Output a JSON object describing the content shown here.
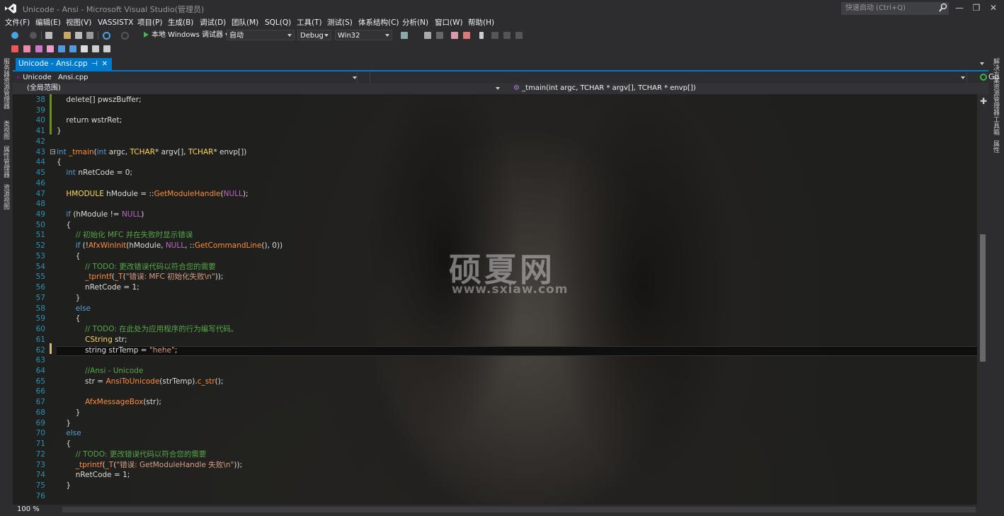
{
  "window": {
    "title": "Unicode - Ansi - Microsoft Visual Studio(管理员)",
    "quick_launch_placeholder": "快速启动 (Ctrl+Q)",
    "minimize": "—",
    "maximize": "❐",
    "close": "✕"
  },
  "menu": [
    "文件(F)",
    "编辑(E)",
    "视图(V)",
    "VASSISTX",
    "项目(P)",
    "生成(B)",
    "调试(D)",
    "团队(M)",
    "SQL(Q)",
    "工具(T)",
    "测试(S)",
    "体系结构(C)",
    "分析(N)",
    "窗口(W)",
    "帮助(H)"
  ],
  "toolbar": {
    "run_label": "本地 Windows 调试器",
    "solution_config": "自动",
    "build_config": "Debug",
    "platform": "Win32"
  },
  "left_tool_tabs": [
    "服务器资源管理器",
    "类视图",
    "属性管理器",
    "资源视图"
  ],
  "right_tool_tabs": [
    "解决方案资源管理器",
    "工具箱",
    "属性"
  ],
  "doc_tab": {
    "label": "Unicode - Ansi.cpp",
    "pin": "⊣",
    "close": "✕"
  },
  "nav": {
    "project": "Unicode",
    "file": "Ansi.cpp",
    "go_label": "Go",
    "scope": "(全局范围)",
    "member": "_tmain(int argc, TCHAR * argv[], TCHAR * envp[])"
  },
  "watermark": {
    "title": "硕夏网",
    "url": "www.sxiaw.com"
  },
  "status": {
    "zoom": "100 %"
  },
  "code_lines": [
    {
      "n": "38",
      "html": "    <span>delete</span>[] pwszBuffer;"
    },
    {
      "n": "39",
      "html": ""
    },
    {
      "n": "40",
      "html": "    <span>return</span> wstrRet;"
    },
    {
      "n": "41",
      "html": "}"
    },
    {
      "n": "42",
      "html": ""
    },
    {
      "n": "43",
      "html": "<span class='kw'>int</span> <span class='fn'>_tmain</span>(<span class='kw'>int</span> argc, <span class='ty'>TCHAR</span>* argv[], <span class='ty'>TCHAR</span>* envp[])"
    },
    {
      "n": "44",
      "html": "{"
    },
    {
      "n": "45",
      "html": "    <span class='kw'>int</span> nRetCode = 0;"
    },
    {
      "n": "46",
      "html": ""
    },
    {
      "n": "47",
      "html": "    <span class='ty'>HMODULE</span> hModule = ::<span class='fn'>GetModuleHandle</span>(<span class='mac'>NULL</span>);"
    },
    {
      "n": "48",
      "html": ""
    },
    {
      "n": "49",
      "html": "    <span class='kw'>if</span> (hModule != <span class='mac'>NULL</span>)"
    },
    {
      "n": "50",
      "html": "    {"
    },
    {
      "n": "51",
      "html": "        <span class='cm'>// 初始化 MFC 并在失败时显示错误</span>"
    },
    {
      "n": "52",
      "html": "        <span class='kw'>if</span> (!<span class='fn'>AfxWinInit</span>(hModule, <span class='mac'>NULL</span>, ::<span class='fn'>GetCommandLine</span>(), 0))"
    },
    {
      "n": "53",
      "html": "        {"
    },
    {
      "n": "54",
      "html": "            <span class='cm'>// TODO: 更改错误代码以符合您的需要</span>"
    },
    {
      "n": "55",
      "html": "            <span class='fn'>_tprintf</span>(<span class='fn'>_T</span>(<span class='str'>\"错误: MFC 初始化失败\\n\"</span>));"
    },
    {
      "n": "56",
      "html": "            nRetCode = 1;"
    },
    {
      "n": "57",
      "html": "        }"
    },
    {
      "n": "58",
      "html": "        <span class='kw'>else</span>"
    },
    {
      "n": "59",
      "html": "        {"
    },
    {
      "n": "60",
      "html": "            <span class='cm'>// TODO: 在此处为应用程序的行为编写代码。</span>"
    },
    {
      "n": "61",
      "html": "            <span class='ty'>CString</span> str;"
    },
    {
      "n": "62",
      "html": "            <span>string</span> strTemp = <span class='str'>\"hehe\"</span>;"
    },
    {
      "n": "63",
      "html": ""
    },
    {
      "n": "64",
      "html": "            <span class='cm'>//Ansi - Unicode</span>"
    },
    {
      "n": "65",
      "html": "            str = <span class='fn'>AnsiToUnicode</span>(strTemp).<span class='fn'>c_str</span>();"
    },
    {
      "n": "66",
      "html": ""
    },
    {
      "n": "67",
      "html": "            <span class='fn'>AfxMessageBox</span>(str);"
    },
    {
      "n": "68",
      "html": "        }"
    },
    {
      "n": "69",
      "html": "    }"
    },
    {
      "n": "70",
      "html": "    <span class='kw'>else</span>"
    },
    {
      "n": "71",
      "html": "    {"
    },
    {
      "n": "72",
      "html": "        <span class='cm'>// TODO: 更改错误代码以符合您的需要</span>"
    },
    {
      "n": "73",
      "html": "        <span class='fn'>_tprintf</span>(<span class='fn'>_T</span>(<span class='str'>\"错误: GetModuleHandle 失败\\n\"</span>));"
    },
    {
      "n": "74",
      "html": "        nRetCode = 1;"
    },
    {
      "n": "75",
      "html": "    }"
    },
    {
      "n": "76",
      "html": ""
    }
  ]
}
